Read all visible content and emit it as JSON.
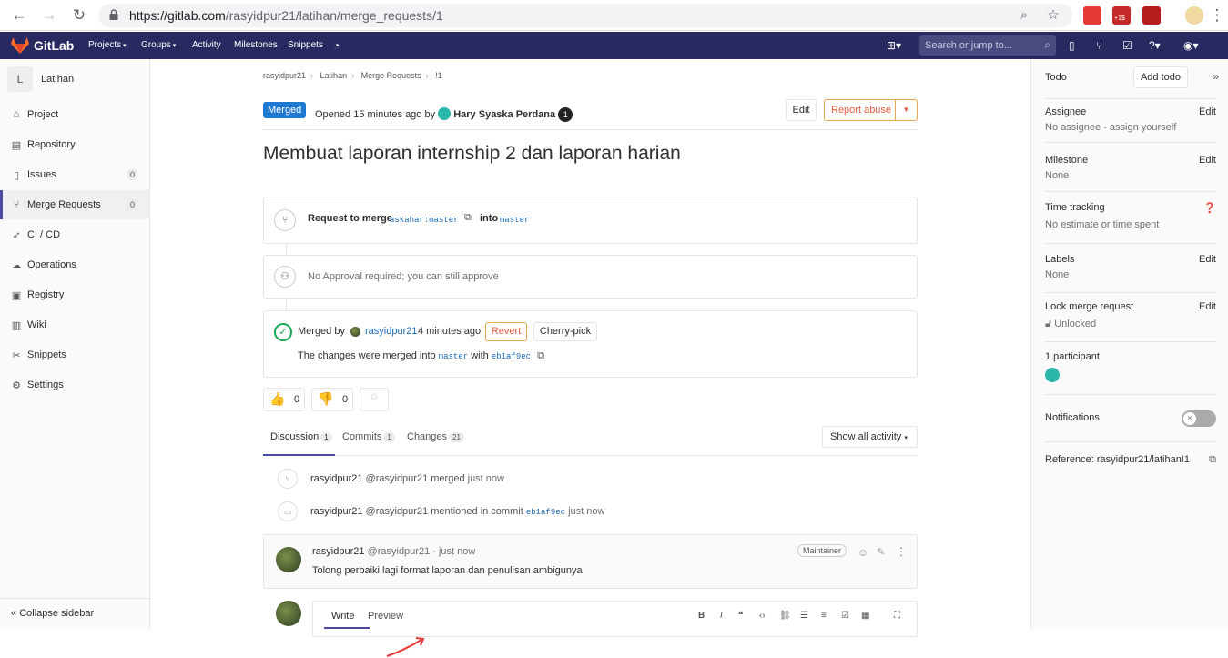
{
  "browser": {
    "url_main": "https://gitlab.com",
    "url_path": "/rasyidpur21/latihan/merge_requests/1",
    "ext_badge": "+1$"
  },
  "navbar": {
    "brand": "GitLab",
    "menu": [
      "Projects",
      "Groups",
      "Activity",
      "Milestones",
      "Snippets"
    ],
    "search_placeholder": "Search or jump to..."
  },
  "sidebar": {
    "project_letter": "L",
    "project_name": "Latihan",
    "items": [
      {
        "label": "Project",
        "icon": "home-icon"
      },
      {
        "label": "Repository",
        "icon": "doc-icon"
      },
      {
        "label": "Issues",
        "icon": "issues-icon",
        "count": "0"
      },
      {
        "label": "Merge Requests",
        "icon": "merge-icon",
        "count": "0"
      },
      {
        "label": "CI / CD",
        "icon": "rocket-icon"
      },
      {
        "label": "Operations",
        "icon": "cloud-icon"
      },
      {
        "label": "Registry",
        "icon": "registry-icon"
      },
      {
        "label": "Wiki",
        "icon": "book-icon"
      },
      {
        "label": "Snippets",
        "icon": "scissors-icon"
      },
      {
        "label": "Settings",
        "icon": "gear-icon"
      }
    ],
    "collapse": "Collapse sidebar"
  },
  "breadcrumb": [
    "rasyidpur21",
    "Latihan",
    "Merge Requests",
    "!1"
  ],
  "header": {
    "status": "Merged",
    "opened": "Opened 15 minutes ago by",
    "author": "Hary Syaska Perdana",
    "edit": "Edit",
    "report": "Report abuse"
  },
  "title": "Membuat laporan internship 2 dan laporan harian",
  "widget": {
    "request_to_merge": "Request to merge",
    "source": "askahar:master",
    "into": "into",
    "target": "master",
    "approval": "No Approval required; you can still approve",
    "merged_by": "Merged by",
    "merged_user": "rasyidpur21",
    "merged_time": "4 minutes ago",
    "revert": "Revert",
    "cherry": "Cherry-pick",
    "changes_text": "The changes were merged into",
    "changes_branch": "master",
    "with": "with",
    "commit": "eb1af9ec"
  },
  "awards": {
    "up": "0",
    "down": "0"
  },
  "tabs": {
    "discussion": "Discussion",
    "discussion_count": "1",
    "commits": "Commits",
    "commits_count": "1",
    "changes": "Changes",
    "changes_count": "21",
    "show_all": "Show all activity"
  },
  "notes": {
    "sys1_user": "rasyidpur21",
    "sys1_handle": "@rasyidpur21",
    "sys1_action": "merged",
    "sys1_time": "just now",
    "sys2_user": "rasyidpur21",
    "sys2_handle": "@rasyidpur21",
    "sys2_action": "mentioned in commit",
    "sys2_commit": "eb1af9ec",
    "sys2_time": "just now",
    "comment_user": "rasyidpur21",
    "comment_handle": "@rasyidpur21 · just now",
    "comment_role": "Maintainer",
    "comment_body": "Tolong perbaiki lagi format laporan dan penulisan ambigunya"
  },
  "editor": {
    "write": "Write",
    "preview": "Preview"
  },
  "right": {
    "todo": "Todo",
    "add_todo": "Add todo",
    "assignee": "Assignee",
    "assignee_val": "No assignee - assign yourself",
    "milestone": "Milestone",
    "milestone_val": "None",
    "time": "Time tracking",
    "time_val": "No estimate or time spent",
    "labels": "Labels",
    "labels_val": "None",
    "lock": "Lock merge request",
    "lock_val": "Unlocked",
    "participants": "1 participant",
    "notifications": "Notifications",
    "reference": "Reference: rasyidpur21/latihan!1",
    "edit": "Edit"
  }
}
